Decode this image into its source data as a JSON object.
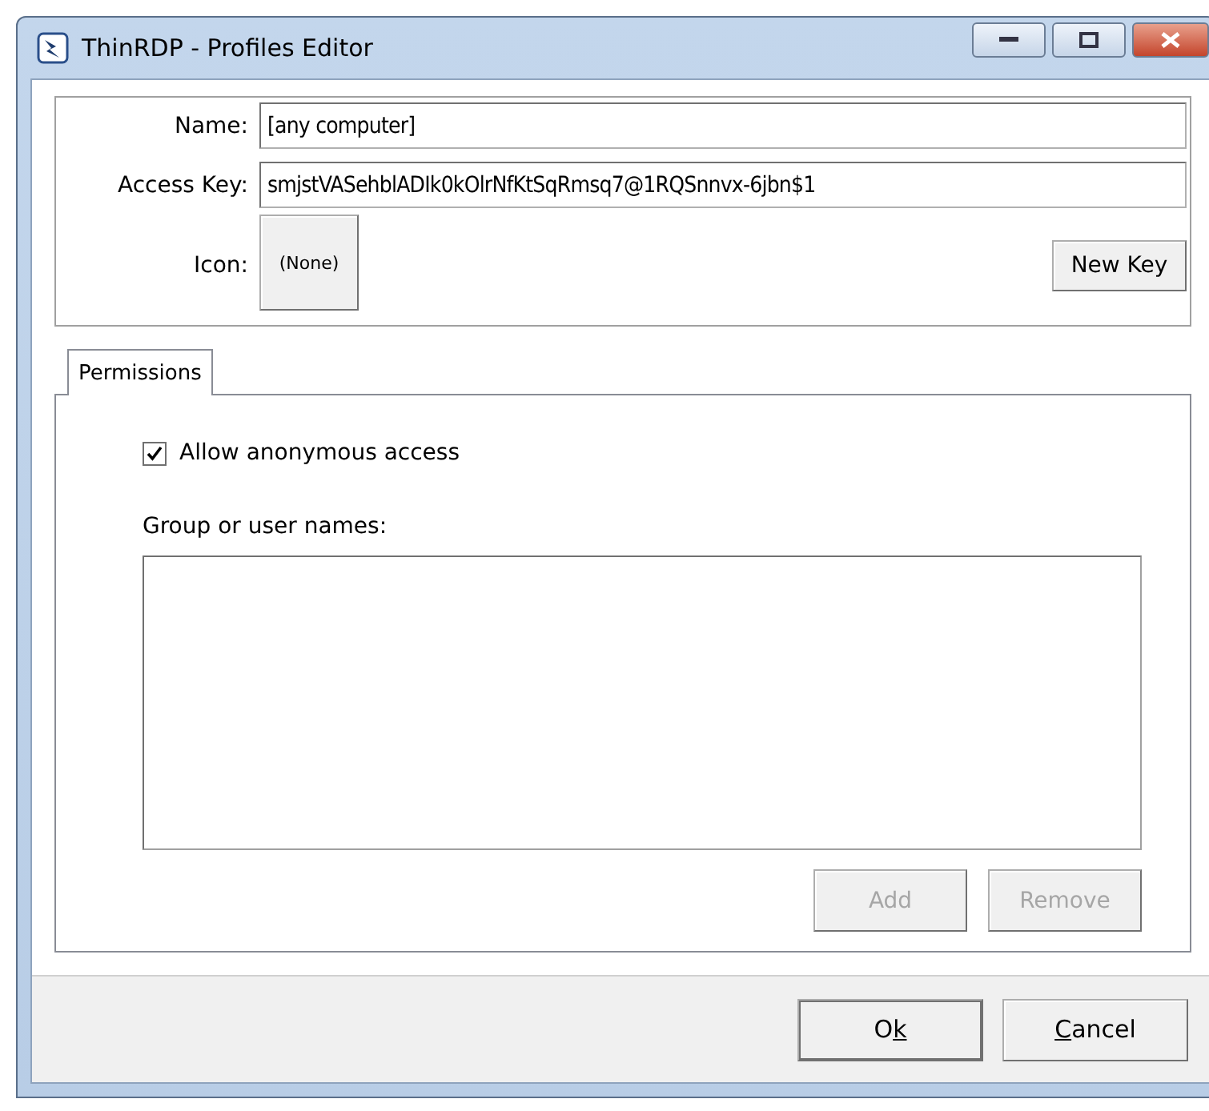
{
  "window": {
    "title": "ThinRDP - Profiles Editor"
  },
  "profile": {
    "name_label": "Name:",
    "name_value": "[any computer]",
    "key_label": "Access Key:",
    "key_value": "smjstVASehblADIk0kOlrNfKtSqRmsq7@1RQSnnvx-6jbn$1",
    "icon_label": "Icon:",
    "icon_button": "(None)",
    "new_key_button": "New Key"
  },
  "tabs": [
    {
      "label": "Permissions",
      "selected": true
    }
  ],
  "permissions": {
    "anonymous": {
      "label": "Allow anonymous access",
      "checked": true
    },
    "list_label": "Group or user names:",
    "buttons": [
      {
        "label": "Add",
        "disabled": true
      },
      {
        "label": "Remove",
        "disabled": true
      }
    ]
  },
  "footer_buttons": [
    {
      "parts": [
        {
          "text": "O",
          "kind": "plain"
        },
        {
          "text": "k",
          "kind": "mnemonic"
        }
      ],
      "default": true
    },
    {
      "parts": [
        {
          "text": "C",
          "kind": "mnemonic"
        },
        {
          "text": "ancel",
          "kind": "plain"
        }
      ],
      "default": false
    }
  ]
}
